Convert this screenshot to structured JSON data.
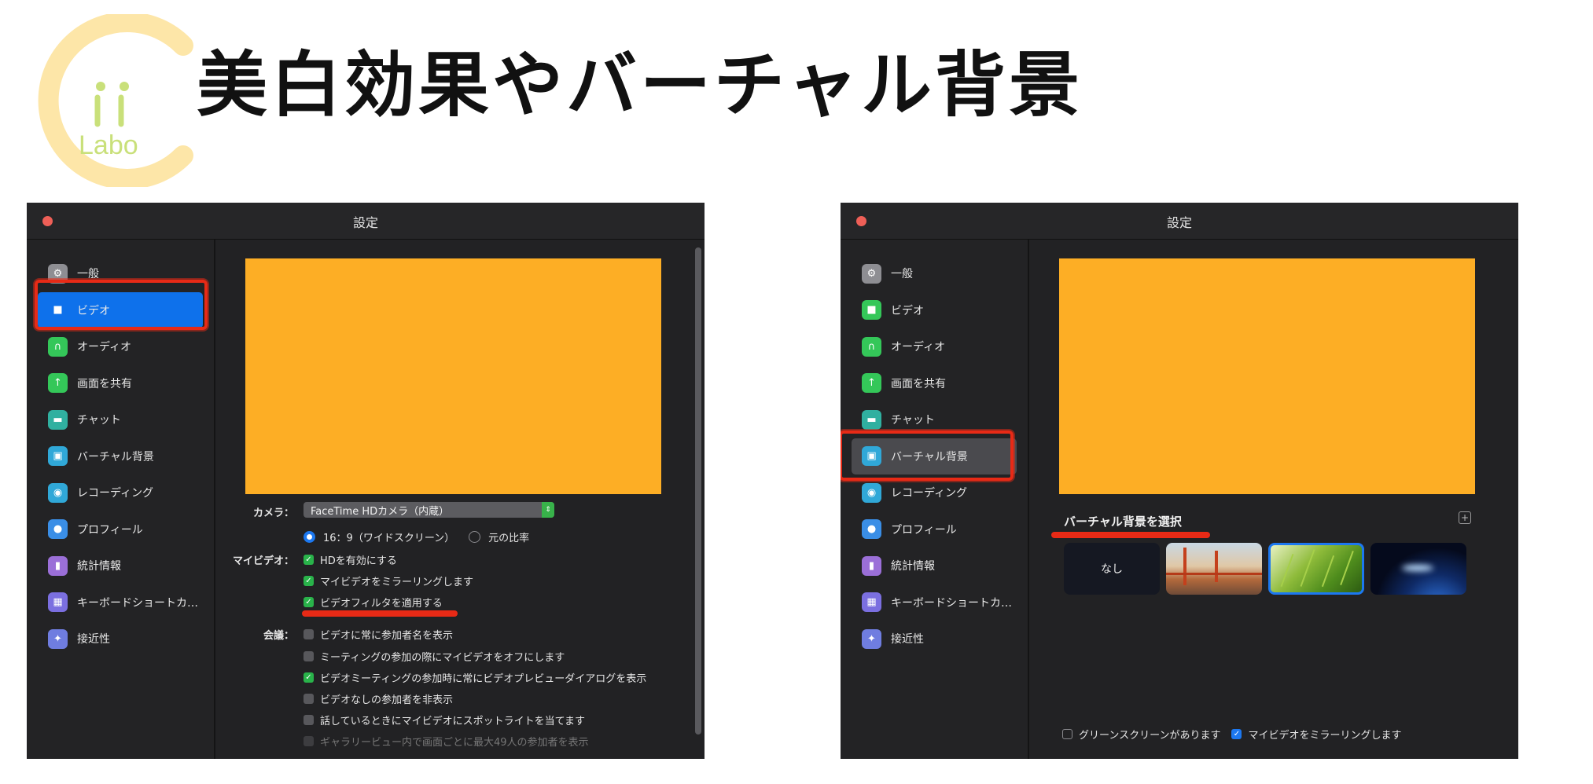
{
  "logo": {
    "line1": "ii",
    "line2": "Labo"
  },
  "headline": "美白効果やバーチャル背景",
  "colors": {
    "accent_blue": "#0e71eb",
    "preview_orange": "#fdae25",
    "check_green": "#29b34a",
    "highlight_red": "#e82a16"
  },
  "window_left": {
    "title": "設定",
    "nav": [
      {
        "label": "一般",
        "icon": "gear-icon",
        "color": "#8e8e93"
      },
      {
        "label": "ビデオ",
        "icon": "video-camera-icon",
        "color": "#0e71eb"
      },
      {
        "label": "オーディオ",
        "icon": "headphones-icon",
        "color": "#34c759"
      },
      {
        "label": "画面を共有",
        "icon": "share-screen-icon",
        "color": "#34c759"
      },
      {
        "label": "チャット",
        "icon": "chat-bubble-icon",
        "color": "#30b0a0"
      },
      {
        "label": "バーチャル背景",
        "icon": "virtual-background-icon",
        "color": "#30a8d8"
      },
      {
        "label": "レコーディング",
        "icon": "record-icon",
        "color": "#30a8d8"
      },
      {
        "label": "プロフィール",
        "icon": "person-icon",
        "color": "#3a8ee6"
      },
      {
        "label": "統計情報",
        "icon": "bar-chart-icon",
        "color": "#9b6fd8"
      },
      {
        "label": "キーボードショートカ…",
        "icon": "keyboard-icon",
        "color": "#7b6fe0"
      },
      {
        "label": "接近性",
        "icon": "accessibility-icon",
        "color": "#6f7de0"
      }
    ],
    "camera_label": "カメラ：",
    "camera_value": "FaceTime HDカメラ（内蔵）",
    "ratio_wide": "16：9（ワイドスクリーン）",
    "ratio_original": "元の比率",
    "myvideo_label": "マイビデオ：",
    "myvideo_options": [
      "HDを有効にする",
      "マイビデオをミラーリングします",
      "ビデオフィルタを適用する"
    ],
    "meeting_label": "会議：",
    "meeting_options": [
      "ビデオに常に参加者名を表示",
      "ミーティングの参加の際にマイビデオをオフにします",
      "ビデオミーティングの参加時に常にビデオプレビューダイアログを表示",
      "ビデオなしの参加者を非表示",
      "話しているときにマイビデオにスポットライトを当てます",
      "ギャラリービュー内で画面ごとに最大49人の参加者を表示"
    ]
  },
  "window_right": {
    "title": "設定",
    "nav": [
      {
        "label": "一般",
        "icon": "gear-icon",
        "color": "#8e8e93"
      },
      {
        "label": "ビデオ",
        "icon": "video-camera-icon",
        "color": "#34c759"
      },
      {
        "label": "オーディオ",
        "icon": "headphones-icon",
        "color": "#34c759"
      },
      {
        "label": "画面を共有",
        "icon": "share-screen-icon",
        "color": "#34c759"
      },
      {
        "label": "チャット",
        "icon": "chat-bubble-icon",
        "color": "#30b0a0"
      },
      {
        "label": "バーチャル背景",
        "icon": "virtual-background-icon",
        "color": "#30a8d8"
      },
      {
        "label": "レコーディング",
        "icon": "record-icon",
        "color": "#30a8d8"
      },
      {
        "label": "プロフィール",
        "icon": "person-icon",
        "color": "#3a8ee6"
      },
      {
        "label": "統計情報",
        "icon": "bar-chart-icon",
        "color": "#9b6fd8"
      },
      {
        "label": "キーボードショートカ…",
        "icon": "keyboard-icon",
        "color": "#7b6fe0"
      },
      {
        "label": "接近性",
        "icon": "accessibility-icon",
        "color": "#6f7de0"
      }
    ],
    "vb_title": "バーチャル背景を選択",
    "thumb_none": "なし",
    "green_screen": "グリーンスクリーンがあります",
    "mirror": "マイビデオをミラーリングします"
  }
}
